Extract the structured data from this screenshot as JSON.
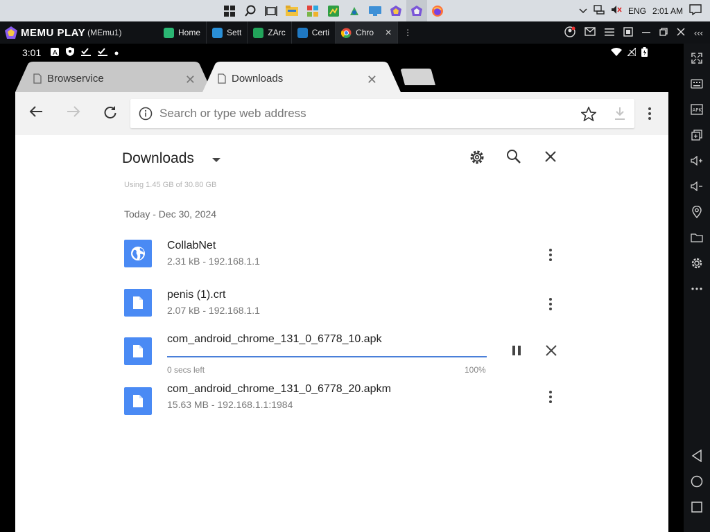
{
  "taskbar": {
    "lang": "ENG",
    "time": "2:01 AM"
  },
  "memu": {
    "brand": "MEMU PLAY",
    "instance": "(MEmu1)",
    "tabs": [
      {
        "label": "Home",
        "color": "#2bb673"
      },
      {
        "label": "Sett",
        "color": "#2a8fd6"
      },
      {
        "label": "ZArc",
        "color": "#22a35a"
      },
      {
        "label": "Certi",
        "color": "#1f78c2"
      },
      {
        "label": "Chro",
        "color": "#e54a3c",
        "active": true
      }
    ]
  },
  "status": {
    "time": "3:01"
  },
  "browser": {
    "tabs": [
      {
        "title": "Browservice",
        "active": false
      },
      {
        "title": "Downloads",
        "active": true
      }
    ],
    "omnibox_placeholder": "Search or type web address"
  },
  "downloads": {
    "title": "Downloads",
    "storage": "Using 1.45 GB of 30.80 GB",
    "date_header": "Today - Dec 30, 2024",
    "items": [
      {
        "name": "CollabNet",
        "meta": "2.31 kB - 192.168.1.1",
        "icon": "globe-icon"
      },
      {
        "name": "penis (1).crt",
        "meta": "2.07 kB - 192.168.1.1",
        "icon": "file-icon"
      },
      {
        "name": "com_android_chrome_131_0_6778_10.apk",
        "status": "0 secs left",
        "percent": "100%",
        "progress": 1.0,
        "icon": "file-icon"
      },
      {
        "name": "com_android_chrome_131_0_6778_20.apkm",
        "meta": "15.63 MB - 192.168.1.1:1984",
        "icon": "file-icon"
      }
    ]
  },
  "colors": {
    "accent": "#4a8af4",
    "progress": "#4a7fd9"
  }
}
